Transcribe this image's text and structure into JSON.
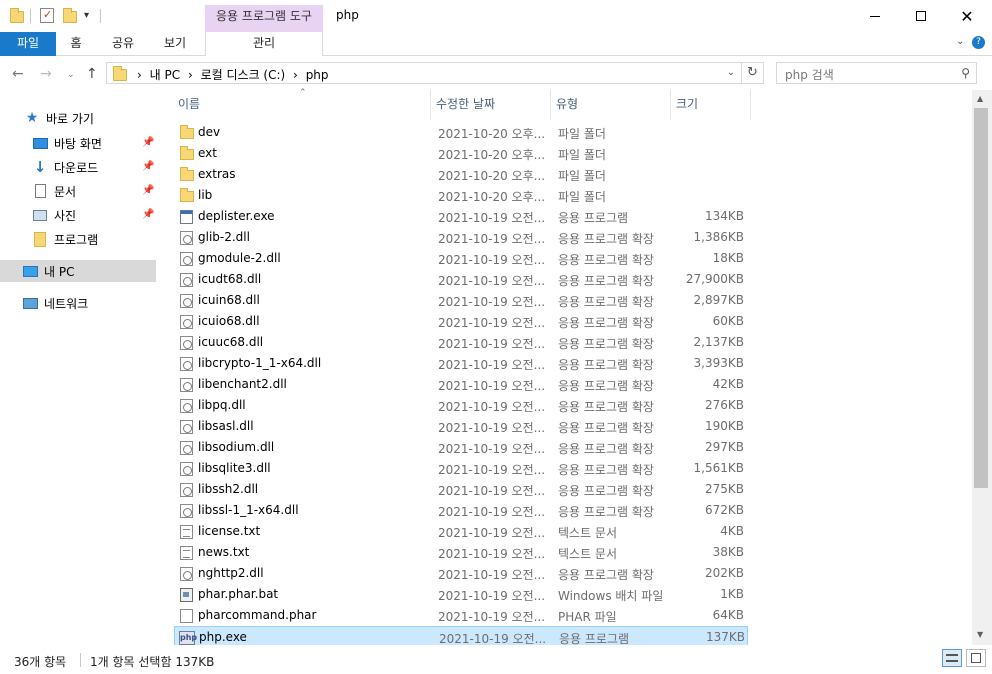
{
  "titlebar": {
    "contextual_tab_title": "응용 프로그램 도구",
    "window_title": "php",
    "minimize_icon": "minimize-icon",
    "maximize_icon": "maximize-icon",
    "close_icon": "close-icon"
  },
  "ribbon": {
    "tabs": [
      "파일",
      "홈",
      "공유",
      "보기",
      "관리"
    ],
    "accent": "#1979ca"
  },
  "address": {
    "crumbs": [
      "내 PC",
      "로컬 디스크 (C:)",
      "php"
    ],
    "search_placeholder": "php 검색"
  },
  "sidebar": {
    "items": [
      {
        "label": "바로 가기",
        "icon": "star-icon"
      },
      {
        "label": "바탕 화면",
        "icon": "desktop-icon",
        "pinned": true
      },
      {
        "label": "다운로드",
        "icon": "download-icon",
        "pinned": true
      },
      {
        "label": "문서",
        "icon": "document-icon",
        "pinned": true
      },
      {
        "label": "사진",
        "icon": "picture-icon",
        "pinned": true
      },
      {
        "label": "프로그램",
        "icon": "folder-icon"
      },
      {
        "label": "내 PC",
        "icon": "computer-icon",
        "selected": true
      },
      {
        "label": "네트워크",
        "icon": "network-icon"
      }
    ]
  },
  "columns": [
    "이름",
    "수정한 날짜",
    "유형",
    "크기"
  ],
  "files": [
    {
      "name": "dev",
      "date": "2021-10-20 오후...",
      "type": "파일 폴더",
      "size": "",
      "kind": "folder"
    },
    {
      "name": "ext",
      "date": "2021-10-20 오후...",
      "type": "파일 폴더",
      "size": "",
      "kind": "folder"
    },
    {
      "name": "extras",
      "date": "2021-10-20 오후...",
      "type": "파일 폴더",
      "size": "",
      "kind": "folder"
    },
    {
      "name": "lib",
      "date": "2021-10-20 오후...",
      "type": "파일 폴더",
      "size": "",
      "kind": "folder"
    },
    {
      "name": "deplister.exe",
      "date": "2021-10-19 오전...",
      "type": "응용 프로그램",
      "size": "134KB",
      "kind": "exe"
    },
    {
      "name": "glib-2.dll",
      "date": "2021-10-19 오전...",
      "type": "응용 프로그램 확장",
      "size": "1,386KB",
      "kind": "dll"
    },
    {
      "name": "gmodule-2.dll",
      "date": "2021-10-19 오전...",
      "type": "응용 프로그램 확장",
      "size": "18KB",
      "kind": "dll"
    },
    {
      "name": "icudt68.dll",
      "date": "2021-10-19 오전...",
      "type": "응용 프로그램 확장",
      "size": "27,900KB",
      "kind": "dll"
    },
    {
      "name": "icuin68.dll",
      "date": "2021-10-19 오전...",
      "type": "응용 프로그램 확장",
      "size": "2,897KB",
      "kind": "dll"
    },
    {
      "name": "icuio68.dll",
      "date": "2021-10-19 오전...",
      "type": "응용 프로그램 확장",
      "size": "60KB",
      "kind": "dll"
    },
    {
      "name": "icuuc68.dll",
      "date": "2021-10-19 오전...",
      "type": "응용 프로그램 확장",
      "size": "2,137KB",
      "kind": "dll"
    },
    {
      "name": "libcrypto-1_1-x64.dll",
      "date": "2021-10-19 오전...",
      "type": "응용 프로그램 확장",
      "size": "3,393KB",
      "kind": "dll"
    },
    {
      "name": "libenchant2.dll",
      "date": "2021-10-19 오전...",
      "type": "응용 프로그램 확장",
      "size": "42KB",
      "kind": "dll"
    },
    {
      "name": "libpq.dll",
      "date": "2021-10-19 오전...",
      "type": "응용 프로그램 확장",
      "size": "276KB",
      "kind": "dll"
    },
    {
      "name": "libsasl.dll",
      "date": "2021-10-19 오전...",
      "type": "응용 프로그램 확장",
      "size": "190KB",
      "kind": "dll"
    },
    {
      "name": "libsodium.dll",
      "date": "2021-10-19 오전...",
      "type": "응용 프로그램 확장",
      "size": "297KB",
      "kind": "dll"
    },
    {
      "name": "libsqlite3.dll",
      "date": "2021-10-19 오전...",
      "type": "응용 프로그램 확장",
      "size": "1,561KB",
      "kind": "dll"
    },
    {
      "name": "libssh2.dll",
      "date": "2021-10-19 오전...",
      "type": "응용 프로그램 확장",
      "size": "275KB",
      "kind": "dll"
    },
    {
      "name": "libssl-1_1-x64.dll",
      "date": "2021-10-19 오전...",
      "type": "응용 프로그램 확장",
      "size": "672KB",
      "kind": "dll"
    },
    {
      "name": "license.txt",
      "date": "2021-10-19 오전...",
      "type": "텍스트 문서",
      "size": "4KB",
      "kind": "txt"
    },
    {
      "name": "news.txt",
      "date": "2021-10-19 오전...",
      "type": "텍스트 문서",
      "size": "38KB",
      "kind": "txt"
    },
    {
      "name": "nghttp2.dll",
      "date": "2021-10-19 오전...",
      "type": "응용 프로그램 확장",
      "size": "202KB",
      "kind": "dll"
    },
    {
      "name": "phar.phar.bat",
      "date": "2021-10-19 오전...",
      "type": "Windows 배치 파일",
      "size": "1KB",
      "kind": "bat"
    },
    {
      "name": "pharcommand.phar",
      "date": "2021-10-19 오전...",
      "type": "PHAR 파일",
      "size": "64KB",
      "kind": "blank"
    },
    {
      "name": "php.exe",
      "date": "2021-10-19 오전...",
      "type": "응용 프로그램",
      "size": "137KB",
      "kind": "php",
      "selected": true
    }
  ],
  "status": {
    "count": "36개 항목",
    "selection": "1개 항목 선택함 137KB"
  }
}
